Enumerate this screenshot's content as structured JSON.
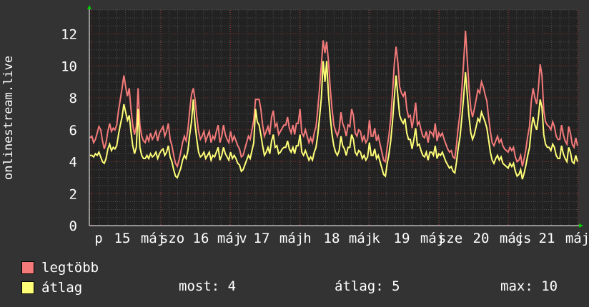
{
  "chart_data": {
    "type": "line",
    "ylabel": "onlinestream.live",
    "ylim": [
      0,
      13.5
    ],
    "yticks": [
      0,
      2,
      4,
      6,
      8,
      10,
      12
    ],
    "xticks": [
      "p",
      "15",
      "máj",
      "szo",
      "16",
      "máj",
      "v",
      "17",
      "máj",
      "h",
      "18",
      "máj",
      "k",
      "19",
      "máj",
      "sze",
      "20",
      "máj",
      "cs",
      "21",
      "máj"
    ],
    "colors": {
      "legtobb": "#f47a7a",
      "atlag": "#ffff77",
      "grid": "#e03030",
      "bg": "#222222"
    },
    "series": [
      {
        "name": "legtöbb",
        "values": [
          5.5,
          5.6,
          5.2,
          5.4,
          5.8,
          6.2,
          6.0,
          5.3,
          4.8,
          5.2,
          5.9,
          6.4,
          5.9,
          6.1,
          6.0,
          6.3,
          7.2,
          7.9,
          8.6,
          9.4,
          8.7,
          8.1,
          8.6,
          7.3,
          6.3,
          5.7,
          6.2,
          8.6,
          6.3,
          5.6,
          5.3,
          5.2,
          5.6,
          5.3,
          5.8,
          5.4,
          5.6,
          5.9,
          5.3,
          5.8,
          6.0,
          6.2,
          5.6,
          5.9,
          6.4,
          5.4,
          5.0,
          4.4,
          3.9,
          3.7,
          4.1,
          4.6,
          5.2,
          5.6,
          5.3,
          6.0,
          7.2,
          8.2,
          8.6,
          7.9,
          6.8,
          5.9,
          5.4,
          5.6,
          5.9,
          5.3,
          5.6,
          5.9,
          5.2,
          5.6,
          5.4,
          5.9,
          6.3,
          5.2,
          5.6,
          6.3,
          5.7,
          5.4,
          5.2,
          5.9,
          5.3,
          5.6,
          5.3,
          5.0,
          4.8,
          4.3,
          4.4,
          4.8,
          5.2,
          5.6,
          5.4,
          6.0,
          6.6,
          7.9,
          7.9,
          7.9,
          7.3,
          6.3,
          5.6,
          5.9,
          6.2,
          5.7,
          6.8,
          7.2,
          6.2,
          6.4,
          5.7,
          5.9,
          6.1,
          6.3,
          6.3,
          6.8,
          6.1,
          5.8,
          6.3,
          5.7,
          6.4,
          6.4,
          7.3,
          5.8,
          5.6,
          6.0,
          5.6,
          5.2,
          5.5,
          5.2,
          5.8,
          6.2,
          7.3,
          8.6,
          10.1,
          11.6,
          10.8,
          11.5,
          10.3,
          8.6,
          7.3,
          6.3,
          5.9,
          5.6,
          6.0,
          7.1,
          6.4,
          6.1,
          5.6,
          6.3,
          6.2,
          7.3,
          6.9,
          5.8,
          5.6,
          6.0,
          5.9,
          5.3,
          5.6,
          5.2,
          5.4,
          6.6,
          5.6,
          5.6,
          6.1,
          5.3,
          5.6,
          5.1,
          4.6,
          4.1,
          4.0,
          4.9,
          5.7,
          6.7,
          8.3,
          10.1,
          11.2,
          10.2,
          8.7,
          8.3,
          8.1,
          8.4,
          7.3,
          6.8,
          6.9,
          6.1,
          6.8,
          7.7,
          6.3,
          6.5,
          6.0,
          5.6,
          5.5,
          5.9,
          5.2,
          5.9,
          5.8,
          5.6,
          6.4,
          5.3,
          5.8,
          5.6,
          5.8,
          5.4,
          5.1,
          4.8,
          4.6,
          4.7,
          4.3,
          4.2,
          5.1,
          6.2,
          7.1,
          8.6,
          10.3,
          12.2,
          10.4,
          8.6,
          7.3,
          6.8,
          7.3,
          7.9,
          8.5,
          8.3,
          9.0,
          8.7,
          8.2,
          7.8,
          6.8,
          5.9,
          5.2,
          5.0,
          5.3,
          5.6,
          5.2,
          5.4,
          5.0,
          4.8,
          4.7,
          4.6,
          4.9,
          4.7,
          4.9,
          4.3,
          4.0,
          4.1,
          4.4,
          3.7,
          4.2,
          4.8,
          5.6,
          6.2,
          7.8,
          8.6,
          8.0,
          7.6,
          8.6,
          10.1,
          9.4,
          7.2,
          6.5,
          6.3,
          6.2,
          6.0,
          6.5,
          6.2,
          5.6,
          5.4,
          5.4,
          6.3,
          5.7,
          5.3,
          5.1,
          6.2,
          5.8,
          5.1,
          4.9,
          5.5,
          5.0
        ]
      },
      {
        "name": "átlag",
        "values": [
          4.4,
          4.4,
          4.3,
          4.5,
          4.4,
          4.6,
          4.3,
          4.0,
          3.9,
          4.2,
          4.8,
          5.1,
          4.7,
          4.9,
          4.8,
          5.0,
          5.7,
          6.3,
          6.8,
          7.6,
          7.1,
          6.6,
          6.9,
          5.9,
          5.0,
          4.5,
          4.9,
          7.3,
          4.9,
          4.4,
          4.2,
          4.2,
          4.4,
          4.2,
          4.5,
          4.3,
          4.4,
          4.6,
          4.2,
          4.5,
          4.7,
          4.8,
          4.4,
          4.6,
          5.0,
          4.3,
          4.0,
          3.5,
          3.1,
          3.0,
          3.3,
          3.6,
          4.1,
          4.4,
          4.2,
          4.7,
          5.7,
          6.5,
          7.9,
          6.3,
          5.4,
          4.6,
          4.3,
          4.4,
          4.6,
          4.2,
          4.4,
          4.6,
          4.1,
          4.4,
          4.3,
          4.6,
          4.9,
          4.1,
          4.4,
          4.9,
          4.5,
          4.3,
          4.1,
          4.6,
          4.2,
          4.4,
          4.2,
          3.9,
          3.8,
          3.4,
          3.5,
          3.8,
          4.1,
          4.4,
          4.2,
          4.7,
          5.2,
          7.3,
          6.5,
          6.3,
          5.7,
          5.0,
          4.4,
          4.6,
          4.9,
          4.5,
          5.3,
          5.7,
          4.9,
          5.0,
          4.5,
          4.6,
          4.8,
          4.9,
          4.9,
          5.3,
          4.8,
          4.6,
          4.9,
          4.5,
          5.0,
          5.0,
          5.7,
          4.6,
          4.4,
          4.7,
          4.4,
          4.1,
          4.3,
          4.1,
          4.6,
          4.9,
          5.7,
          6.8,
          8.0,
          10.3,
          9.0,
          10.3,
          8.2,
          6.8,
          5.7,
          5.0,
          4.6,
          4.4,
          4.7,
          5.6,
          5.0,
          4.8,
          4.4,
          4.9,
          4.9,
          5.7,
          5.4,
          4.6,
          4.4,
          4.7,
          4.6,
          4.2,
          4.4,
          4.1,
          4.3,
          5.2,
          4.4,
          4.4,
          4.8,
          4.2,
          4.4,
          4.0,
          3.6,
          3.2,
          3.1,
          3.9,
          4.5,
          5.3,
          6.5,
          8.0,
          9.4,
          8.1,
          6.9,
          6.6,
          6.4,
          6.7,
          5.8,
          5.4,
          5.4,
          4.8,
          5.4,
          6.1,
          5.0,
          5.1,
          4.7,
          4.4,
          4.3,
          4.6,
          4.1,
          4.6,
          4.6,
          4.4,
          5.0,
          4.2,
          4.5,
          4.4,
          4.6,
          4.3,
          4.0,
          3.8,
          3.6,
          3.7,
          3.4,
          3.3,
          4.0,
          4.9,
          5.6,
          6.8,
          8.1,
          9.6,
          8.2,
          6.8,
          5.8,
          5.4,
          5.7,
          6.2,
          6.7,
          6.5,
          7.1,
          6.8,
          6.5,
          6.1,
          5.4,
          4.6,
          4.1,
          3.9,
          4.2,
          4.4,
          4.1,
          4.3,
          3.9,
          3.8,
          3.7,
          3.6,
          3.9,
          3.7,
          3.9,
          3.4,
          3.1,
          3.2,
          3.5,
          2.9,
          3.3,
          3.8,
          4.4,
          4.9,
          6.1,
          6.8,
          6.3,
          6.0,
          6.8,
          7.9,
          7.4,
          5.7,
          5.1,
          4.9,
          4.9,
          4.7,
          5.1,
          4.9,
          4.4,
          4.2,
          4.2,
          5.0,
          4.5,
          4.2,
          4.0,
          4.9,
          4.6,
          4.0,
          3.9,
          4.4,
          4.0
        ]
      }
    ]
  },
  "legend": {
    "items": [
      {
        "label": "legtöbb",
        "color": "#f47a7a"
      },
      {
        "label": "átlag",
        "color": "#ffff77"
      }
    ],
    "stats": {
      "most": "most: 4",
      "atlag": "átlag: 5",
      "max": "max: 10"
    }
  }
}
